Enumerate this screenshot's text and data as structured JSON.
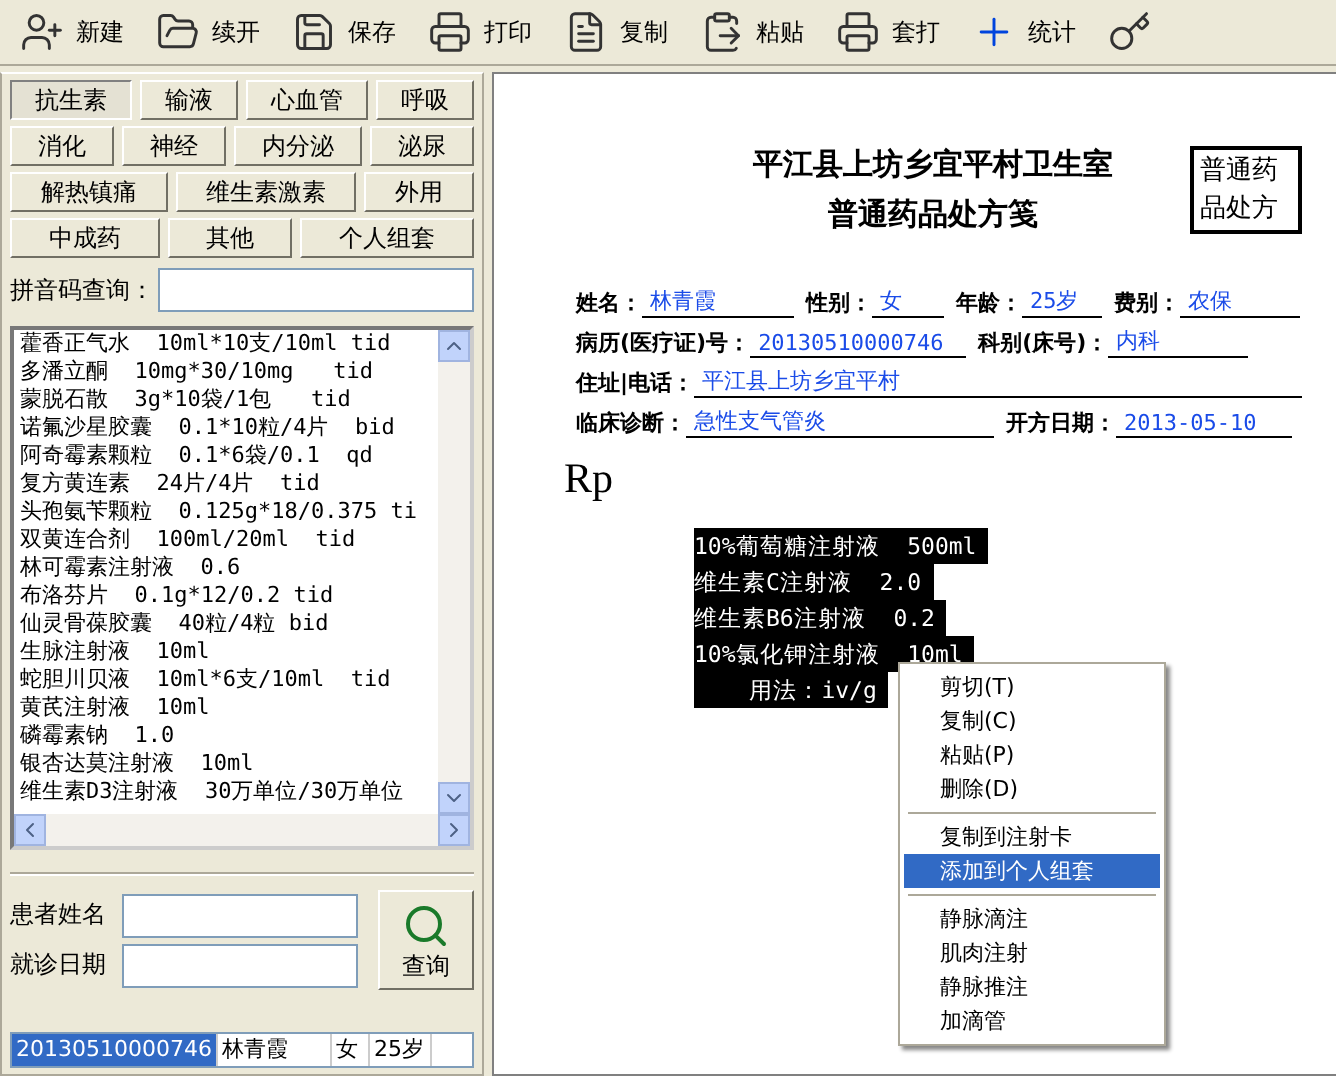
{
  "toolbar": [
    {
      "kind": "new",
      "label": "新建"
    },
    {
      "kind": "open",
      "label": "续开"
    },
    {
      "kind": "save",
      "label": "保存"
    },
    {
      "kind": "print",
      "label": "打印"
    },
    {
      "kind": "copy",
      "label": "复制"
    },
    {
      "kind": "paste",
      "label": "粘贴"
    },
    {
      "kind": "print",
      "label": "套打"
    },
    {
      "kind": "stats",
      "label": "统计"
    },
    {
      "kind": "key"
    }
  ],
  "categories": [
    [
      {
        "label": "抗生素",
        "selected": true
      },
      {
        "label": "输液",
        "selected": false
      },
      {
        "label": "心血管",
        "selected": false
      },
      {
        "label": "呼吸",
        "selected": false
      }
    ],
    [
      {
        "label": "消化",
        "selected": false
      },
      {
        "label": "神经",
        "selected": false
      },
      {
        "label": "内分泌",
        "selected": false
      },
      {
        "label": "泌尿",
        "selected": false
      }
    ],
    [
      {
        "label": "解热镇痛",
        "selected": false
      },
      {
        "label": "维生素激素",
        "selected": false
      },
      {
        "label": "外用",
        "selected": false
      }
    ],
    [
      {
        "label": "中成药",
        "selected": false
      },
      {
        "label": "其他",
        "selected": false
      },
      {
        "label": "个人组套",
        "selected": false
      }
    ]
  ],
  "pinyin_search": {
    "label": "拼音码查询："
  },
  "drug_list": [
    "藿香正气水  10ml*10支/10ml tid",
    "多潘立酮  10mg*30/10mg   tid",
    "蒙脱石散  3g*10袋/1包   tid",
    "诺氟沙星胶囊  0.1*10粒/4片  bid",
    "阿奇霉素颗粒  0.1*6袋/0.1  qd",
    "复方黄连素  24片/4片  tid",
    "头孢氨苄颗粒  0.125g*18/0.375 ti",
    "双黄连合剂  100ml/20ml  tid",
    "林可霉素注射液  0.6",
    "布洛芬片  0.1g*12/0.2 tid",
    "仙灵骨葆胶囊  40粒/4粒 bid",
    "生脉注射液  10ml",
    "蛇胆川贝液  10ml*6支/10ml  tid",
    "黄芪注射液  10ml",
    "磷霉素钠  1.0",
    "银杏达莫注射液  10ml",
    "维生素D3注射液  30万单位/30万单位"
  ],
  "patient_search": {
    "name_label": "患者姓名",
    "date_label": "就诊日期",
    "button": "查询"
  },
  "patients": [
    {
      "cells": [
        "20130510000746",
        "林青霞",
        "女",
        "25岁"
      ],
      "selected": true
    }
  ],
  "prescription": {
    "clinic": "平江县上坊乡宜平村卫生室",
    "title": "普通药品处方笺",
    "stamp": "普通药品处方",
    "name": {
      "label": "姓名：",
      "value": "林青霞"
    },
    "gender": {
      "label": "性别：",
      "value": "女"
    },
    "age": {
      "label": "年龄：",
      "value": "25岁"
    },
    "fee_type": {
      "label": "费别：",
      "value": "农保"
    },
    "record_no": {
      "label": "病历(医疗证)号：",
      "value": "20130510000746"
    },
    "department": {
      "label": "科别(床号)：",
      "value": "内科"
    },
    "address_phone": {
      "label": "住址|电话：",
      "value": "平江县上坊乡宜平村"
    },
    "diagnosis": {
      "label": "临床诊断：",
      "value": "急性支气管炎"
    },
    "date": {
      "label": "开方日期：",
      "value": "2013-05-10"
    },
    "rp": "Rp",
    "lines": [
      "10%葡萄糖注射液  500ml",
      "维生素C注射液  2.0",
      "维生素B6注射液  0.2",
      "10%氯化钾注射液  10ml",
      "    用法：iv/g"
    ]
  },
  "context_menu": [
    [
      {
        "label": "剪切(T)",
        "selected": false
      },
      {
        "label": "复制(C)",
        "selected": false
      },
      {
        "label": "粘贴(P)",
        "selected": false
      },
      {
        "label": "删除(D)",
        "selected": false
      }
    ],
    [
      {
        "label": "复制到注射卡",
        "selected": false
      },
      {
        "label": "添加到个人组套",
        "selected": true
      }
    ],
    [
      {
        "label": "静脉滴注",
        "selected": false
      },
      {
        "label": "肌肉注射",
        "selected": false
      },
      {
        "label": "静脉推注",
        "selected": false
      },
      {
        "label": "加滴管",
        "selected": false
      }
    ]
  ]
}
